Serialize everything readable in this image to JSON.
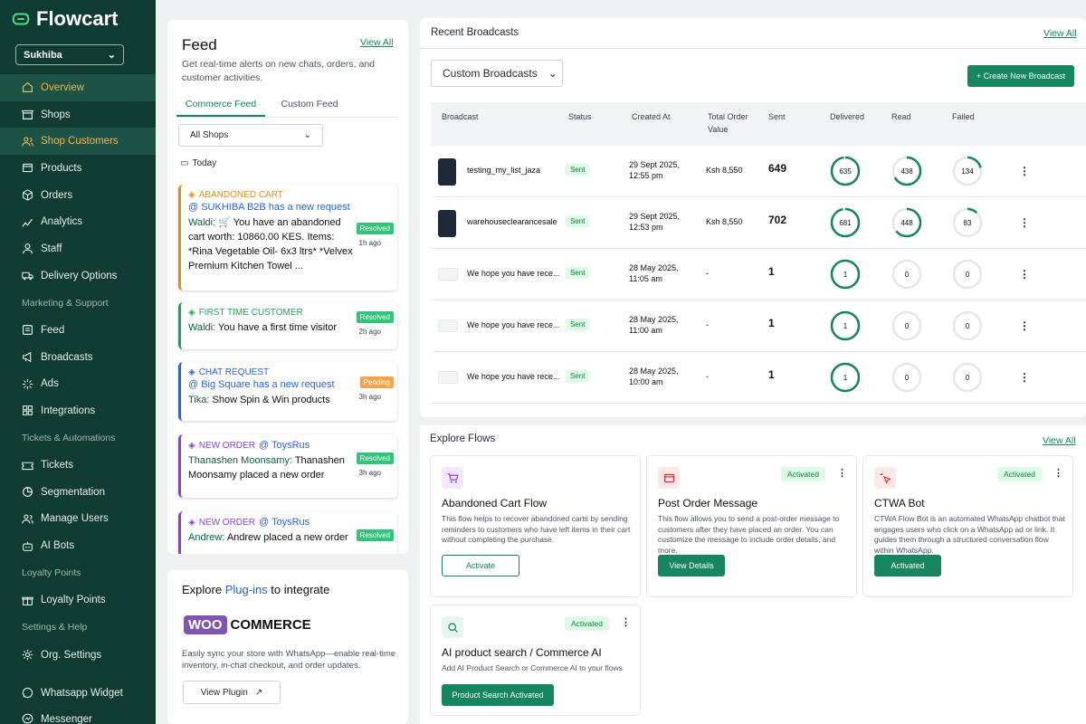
{
  "app": {
    "name": "Flowcart"
  },
  "sidebar": {
    "shop": "Sukhiba",
    "items": [
      {
        "label": "Overview",
        "icon": "home-icon",
        "active": true
      },
      {
        "label": "Shops",
        "icon": "store-icon"
      },
      {
        "label": "Shop Customers",
        "icon": "users-icon",
        "highlight": true
      },
      {
        "label": "Products",
        "icon": "box-icon"
      },
      {
        "label": "Orders",
        "icon": "package-icon"
      },
      {
        "label": "Analytics",
        "icon": "chart-icon"
      },
      {
        "label": "Staff",
        "icon": "person-icon"
      },
      {
        "label": "Delivery Options",
        "icon": "truck-icon"
      }
    ],
    "sections": [
      {
        "title": "Marketing & Support",
        "items": [
          {
            "label": "Feed",
            "icon": "list-icon"
          },
          {
            "label": "Broadcasts",
            "icon": "megaphone-icon"
          },
          {
            "label": "Ads",
            "icon": "sparkle-icon"
          },
          {
            "label": "Integrations",
            "icon": "grid-icon"
          }
        ]
      },
      {
        "title": "Tickets & Automations",
        "items": [
          {
            "label": "Tickets",
            "icon": "ticket-icon"
          },
          {
            "label": "Segmentation",
            "icon": "segment-icon"
          },
          {
            "label": "Manage Users",
            "icon": "users-icon"
          },
          {
            "label": "AI Bots",
            "icon": "bot-icon"
          }
        ]
      },
      {
        "title": "Loyalty Points",
        "items": [
          {
            "label": "Loyalty Points",
            "icon": "gift-icon"
          }
        ]
      },
      {
        "title": "Settings & Help",
        "items": [
          {
            "label": "Org. Settings",
            "icon": "gear-icon"
          }
        ]
      }
    ],
    "bottom": [
      {
        "label": "Whatsapp Widget",
        "icon": "whatsapp-icon"
      },
      {
        "label": "Messenger",
        "icon": "messenger-icon"
      }
    ]
  },
  "feed": {
    "title": "Feed",
    "view_all": "View All",
    "description": "Get real-time alerts on new chats, orders, and customer activities.",
    "tabs": [
      "Commerce Feed",
      "Custom Feed"
    ],
    "filter": "All Shops",
    "date_label": "Today",
    "alerts": [
      {
        "type": "ABANDONED CART",
        "color": "#d9930e",
        "mention": "@ SUKHIBA B2B has a new request",
        "sender": "Waldi:",
        "text": "🛒 You have an abandoned cart worth: 10860.00 KES. Items: *Rina Vegetable Oil- 6x3 ltrs* *Velvex Premium Kitchen Towel ...",
        "status": "Resolved",
        "ago": "1h ago"
      },
      {
        "type": "FIRST TIME CUSTOMER",
        "color": "#22a05b",
        "mention": "",
        "sender": "Waldi:",
        "text": "You have a first time visitor",
        "status": "Resolved",
        "ago": "2h ago"
      },
      {
        "type": "CHAT REQUEST",
        "color": "#2563eb",
        "mention": "@ Big Square has a new request",
        "sender": "Tika:",
        "text": "Show Spin & Win products",
        "status": "Pending",
        "ago": "3h ago"
      },
      {
        "type": "NEW ORDER",
        "color": "#8b3fd6",
        "type_mention": "@ ToysRus",
        "mention": "",
        "sender": "Thanashen Moonsamy:",
        "text": "Thanashen Moonsamy placed a new order",
        "status": "Resolved",
        "ago": "3h ago"
      },
      {
        "type": "NEW ORDER",
        "color": "#8b3fd6",
        "type_mention": "@ ToysRus",
        "mention": "",
        "sender": "Andrew:",
        "text": "Andrew placed a new order",
        "status": "Resolved",
        "ago": ""
      }
    ]
  },
  "plugins": {
    "title_prefix": "Explore",
    "title_link": "Plug-ins",
    "title_suffix": "to integrate",
    "logo_box": "WOO",
    "logo_text": "COMMERCE",
    "description": "Easily sync your store with WhatsApp—enable real-time inventory, in-chat checkout, and order updates.",
    "button": "View Plugin"
  },
  "broadcasts": {
    "title": "Recent Broadcasts",
    "view_all": "View All",
    "filter": "Custom Broadcasts",
    "create_button": "+ Create New Broadcast",
    "columns": [
      "Broadcast",
      "Status",
      "Created At",
      "Total Order Value",
      "Sent",
      "Delivered",
      "Read",
      "Failed"
    ],
    "rows": [
      {
        "name": "testing_my_list_jaza",
        "status": "Sent",
        "date": "29 Sept 2025,",
        "time": "12:55 pm",
        "value": "Ksh 8,550",
        "sent": "649",
        "delivered": "635",
        "read": "438",
        "failed": "134",
        "thumb": true,
        "delivered_pct": 0.98,
        "read_pct": 0.67,
        "failed_pct": 0.21
      },
      {
        "name": "warehouseclearancesale",
        "status": "Sent",
        "date": "29 Sept 2025,",
        "time": "12:53 pm",
        "value": "Ksh 8,550",
        "sent": "702",
        "delivered": "681",
        "read": "448",
        "failed": "83",
        "thumb": true,
        "delivered_pct": 0.97,
        "read_pct": 0.64,
        "failed_pct": 0.12
      },
      {
        "name": "We hope you have rece...",
        "status": "Sent",
        "date": "28 May 2025,",
        "time": "11:05 am",
        "value": "-",
        "sent": "1",
        "delivered": "1",
        "read": "0",
        "failed": "0",
        "thumb": false,
        "delivered_pct": 1,
        "read_pct": 0,
        "failed_pct": 0
      },
      {
        "name": "We hope you have rece...",
        "status": "Sent",
        "date": "28 May 2025,",
        "time": "11:00 am",
        "value": "-",
        "sent": "1",
        "delivered": "1",
        "read": "0",
        "failed": "0",
        "thumb": false,
        "delivered_pct": 1,
        "read_pct": 0,
        "failed_pct": 0
      },
      {
        "name": "We hope you have rece...",
        "status": "Sent",
        "date": "28 May 2025,",
        "time": "10:00 am",
        "value": "-",
        "sent": "1",
        "delivered": "1",
        "read": "0",
        "failed": "0",
        "thumb": false,
        "delivered_pct": 1,
        "read_pct": 0,
        "failed_pct": 0
      }
    ]
  },
  "flows": {
    "title": "Explore Flows",
    "view_all": "View All",
    "items": [
      {
        "name": "Abandoned Cart Flow",
        "icon": "cart-icon",
        "icon_bg": "#f3e8ff",
        "icon_color": "#8b3fd6",
        "tag": "",
        "description": "This flow helps to recover abandoned carts by sending reminders to customers who have left items in their cart without completing the purchase.",
        "button": "Activate",
        "button_style": "outline"
      },
      {
        "name": "Post Order Message",
        "icon": "box-icon",
        "icon_bg": "#fde8e8",
        "icon_color": "#dc2626",
        "tag": "Activated",
        "description": "This flow allows you to send a post-order message to customers after they have placed an order. You can customize the message to include order details, and more.",
        "button": "View Details",
        "button_style": "solid"
      },
      {
        "name": "CTWA Bot",
        "icon": "cursor-click-icon",
        "icon_bg": "#fde8e8",
        "icon_color": "#dc2626",
        "tag": "Activated",
        "description": "CTWA Flow Bot is an automated WhatsApp chatbot that engages users who click on a WhatsApp ad or link. It guides them through a structured conversation flow within WhatsApp.",
        "button": "Activated",
        "button_style": "solid"
      },
      {
        "name": "AI product search / Commerce AI",
        "icon": "search-icon",
        "icon_bg": "#e6f6ef",
        "icon_color": "#15865e",
        "tag": "Activated",
        "description": "Add AI Product Search or Commerce AI to your flows",
        "button": "Product Search Activated",
        "button_style": "solid"
      }
    ]
  },
  "colors": {
    "brand": "#15865e",
    "sidebar": "#0f3b32",
    "accent": "#f3b64a"
  }
}
